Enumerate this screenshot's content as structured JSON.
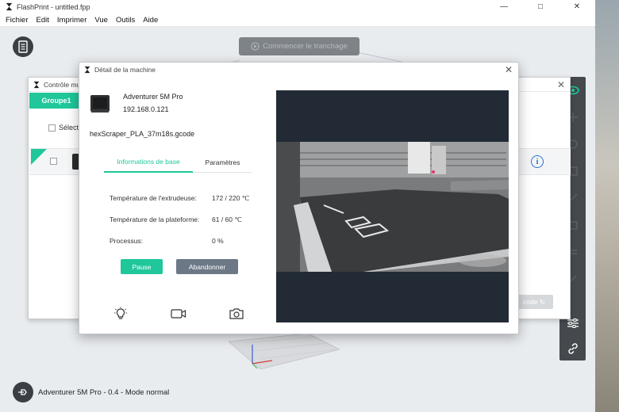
{
  "app": {
    "title": "FlashPrint - untitled.fpp",
    "window_controls": [
      "minimize",
      "maximize",
      "close"
    ]
  },
  "menu": [
    "Fichier",
    "Edit",
    "Imprimer",
    "Vue",
    "Outils",
    "Aide"
  ],
  "toolbar": {
    "slice_button": "Commencer le tranchage"
  },
  "status": {
    "machine": "Adventurer 5M Pro - 0.4 - Mode normal"
  },
  "multi_control": {
    "title": "Contrôle mu",
    "group_tab": "Groupe1",
    "select_label": "Sélecti",
    "start_slice_ghost": "code ↻"
  },
  "dialog": {
    "title": "Détail de la machine",
    "machine_name": "Adventurer 5M Pro",
    "ip": "192.168.0.121",
    "file": "hexScraper_PLA_37m18s.gcode",
    "tabs": {
      "basic": "Informations de base",
      "params": "Paramètres"
    },
    "info": [
      {
        "label": "Température de l'extrudeuse:",
        "value": "172 / 220 ℃"
      },
      {
        "label": "Température de la plateforme:",
        "value": "61 / 60 ℃"
      },
      {
        "label": "Processus:",
        "value": "0 %"
      }
    ],
    "buttons": {
      "pause": "Pause",
      "abort": "Abandonner"
    }
  },
  "colors": {
    "accent": "#1fc79a",
    "abort": "#6d7886",
    "info_blue": "#2a6fd6",
    "toolbar_dark": "#45494e"
  }
}
